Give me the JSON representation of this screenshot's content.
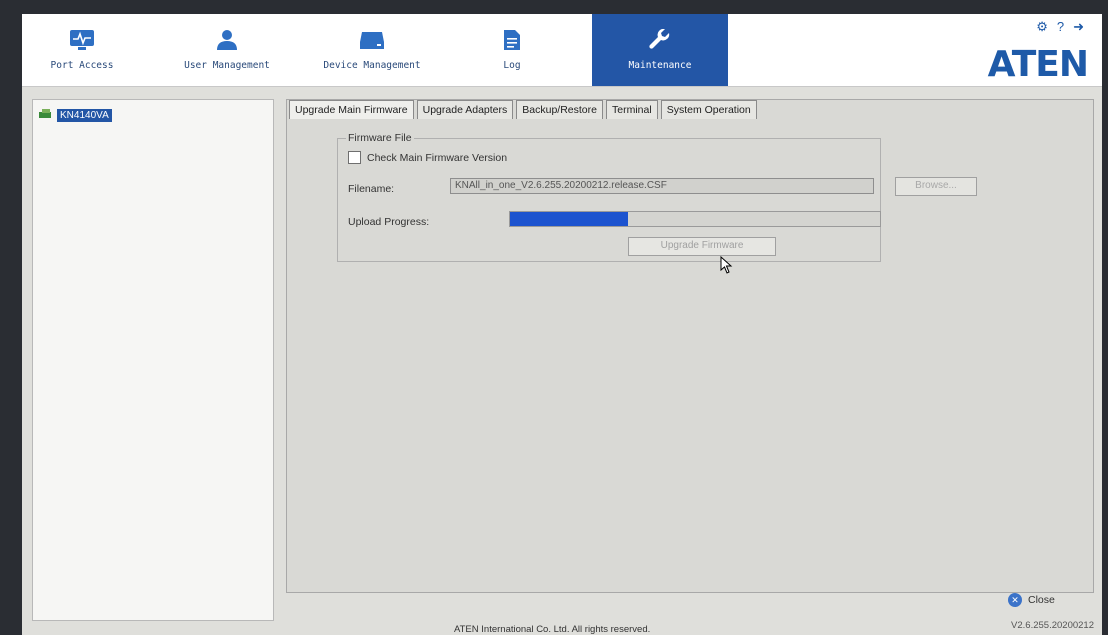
{
  "nav": {
    "items": [
      {
        "label": "Port Access",
        "icon": "monitor-pulse-icon"
      },
      {
        "label": "User Management",
        "icon": "user-icon"
      },
      {
        "label": "Device Management",
        "icon": "device-icon"
      },
      {
        "label": "Log",
        "icon": "document-icon"
      },
      {
        "label": "Maintenance",
        "icon": "wrench-icon",
        "active": true
      }
    ]
  },
  "header": {
    "logo": "ATEN",
    "icons": [
      "settings-icon",
      "help-icon",
      "logout-icon"
    ]
  },
  "sidebar": {
    "device": "KN4140VA"
  },
  "tabs": [
    {
      "label": "Upgrade Main Firmware",
      "active": true
    },
    {
      "label": "Upgrade Adapters"
    },
    {
      "label": "Backup/Restore"
    },
    {
      "label": "Terminal"
    },
    {
      "label": "System Operation"
    }
  ],
  "firmware": {
    "group_title": "Firmware File",
    "check_label": "Check Main Firmware Version",
    "checked": false,
    "filename_label": "Filename:",
    "filename_value": "KNAll_in_one_V2.6.255.20200212.release.CSF",
    "browse_label": "Browse...",
    "progress_label": "Upload Progress:",
    "progress_fraction": 0.32,
    "upgrade_label": "Upgrade Firmware"
  },
  "footer": {
    "close_label": "Close",
    "copyright": "ATEN International Co. Ltd. All rights reserved.",
    "version": "V2.6.255.20200212"
  },
  "colors": {
    "accent": "#2356a6",
    "progress": "#1c53cf"
  }
}
